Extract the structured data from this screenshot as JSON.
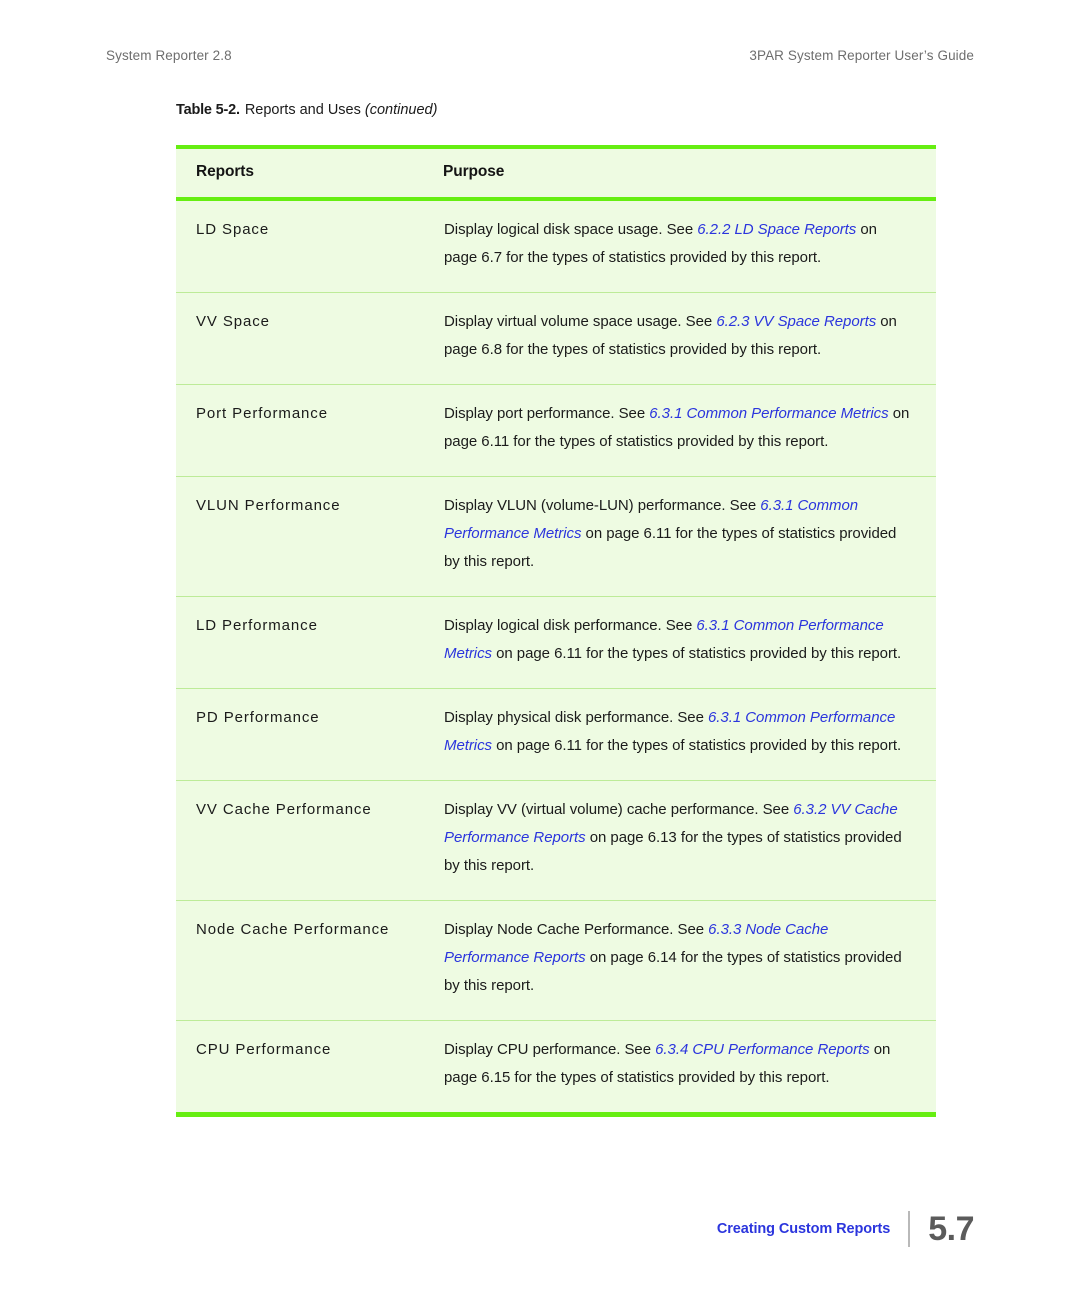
{
  "running_head": {
    "left": "System Reporter 2.8",
    "right": "3PAR System Reporter User’s Guide"
  },
  "caption": {
    "label": "Table 5-2.",
    "title": "Reports and Uses",
    "continued": "(continued)"
  },
  "table": {
    "columns": {
      "reports": "Reports",
      "purpose": "Purpose"
    },
    "rows": [
      {
        "name": "LD Space",
        "desc_parts": [
          {
            "text": "Display logical disk space usage. See ",
            "style": "plain"
          },
          {
            "text": "6.2.2 LD Space Reports",
            "style": "link"
          },
          {
            "text": " on page 6.7 for the types of statistics provided by this report.",
            "style": "plain"
          }
        ]
      },
      {
        "name": "VV Space",
        "desc_parts": [
          {
            "text": "Display virtual volume space usage. See ",
            "style": "plain"
          },
          {
            "text": "6.2.3 VV Space Reports",
            "style": "link"
          },
          {
            "text": " on page 6.8 for the types of statistics provided by this report.",
            "style": "plain"
          }
        ]
      },
      {
        "name": "Port Performance",
        "desc_parts": [
          {
            "text": "Display port performance. See ",
            "style": "plain"
          },
          {
            "text": "6.3.1 Common Performance Metrics",
            "style": "link"
          },
          {
            "text": " on page 6.11 for the types of statistics provided by this report.",
            "style": "plain"
          }
        ]
      },
      {
        "name": "VLUN Performance",
        "desc_parts": [
          {
            "text": "Display VLUN (volume-LUN) performance. See ",
            "style": "plain"
          },
          {
            "text": "6.3.1 Common Performance Metrics",
            "style": "link"
          },
          {
            "text": " on page 6.11 for the types of statistics provided by this report.",
            "style": "plain"
          }
        ]
      },
      {
        "name": "LD Performance",
        "desc_parts": [
          {
            "text": "Display logical disk performance. See ",
            "style": "plain"
          },
          {
            "text": "6.3.1 Common Performance Metrics",
            "style": "link"
          },
          {
            "text": " on page 6.11 for the types of statistics provided by this report.",
            "style": "plain"
          }
        ]
      },
      {
        "name": "PD Performance",
        "desc_parts": [
          {
            "text": "Display physical disk performance. See ",
            "style": "plain"
          },
          {
            "text": "6.3.1 Common Performance Metrics",
            "style": "link"
          },
          {
            "text": " on page 6.11 for the types of statistics provided by this report.",
            "style": "plain"
          }
        ]
      },
      {
        "name": "VV Cache Performance",
        "desc_parts": [
          {
            "text": "Display VV (virtual volume) cache performance. See ",
            "style": "plain"
          },
          {
            "text": "6.3.2 VV Cache Performance Reports",
            "style": "link"
          },
          {
            "text": " on page 6.13 for the types of statistics provided by this report.",
            "style": "plain"
          }
        ]
      },
      {
        "name": "Node Cache Performance",
        "desc_parts": [
          {
            "text": "Display Node Cache Performance. See ",
            "style": "plain"
          },
          {
            "text": "6.3.3 Node Cache Performance Reports",
            "style": "link"
          },
          {
            "text": " on page 6.14 for the types of statistics provided by this report.",
            "style": "plain"
          }
        ]
      },
      {
        "name": "CPU Performance",
        "desc_parts": [
          {
            "text": "Display CPU performance. See ",
            "style": "plain"
          },
          {
            "text": "6.3.4 CPU Performance Reports",
            "style": "link"
          },
          {
            "text": " on page 6.15 for the types of statistics provided by this report.",
            "style": "plain"
          }
        ]
      }
    ]
  },
  "footer": {
    "title": "Creating Custom Reports",
    "page_number": "5.7"
  },
  "colors": {
    "rule_bright_green": "#66ee11",
    "row_separator_green": "#bdeb98",
    "cell_fill_green": "#eefbe2",
    "link_blue": "#2b35dd",
    "running_head_gray": "#6e6e6e",
    "page_number_gray": "#5b5b5b"
  }
}
